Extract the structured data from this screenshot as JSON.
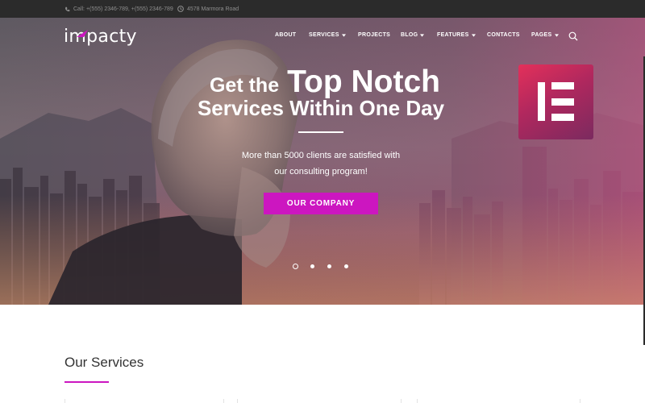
{
  "topbar": {
    "phone_icon": "phone-icon",
    "phone_text": "Call: +(555) 2346-789, +(555) 2346-789",
    "clock_icon": "clock-icon",
    "address_text": "4578 Marmora Road"
  },
  "header": {
    "logo_text": "impacty",
    "nav": [
      {
        "label": "ABOUT",
        "dropdown": false
      },
      {
        "label": "SERVICES",
        "dropdown": true
      },
      {
        "label": "PROJECTS",
        "dropdown": false
      },
      {
        "label": "BLOG",
        "dropdown": true
      },
      {
        "label": "FEATURES",
        "dropdown": true
      },
      {
        "label": "CONTACTS",
        "dropdown": false
      },
      {
        "label": "PAGES",
        "dropdown": true
      }
    ],
    "search_icon": "search-icon"
  },
  "hero": {
    "headline_small": "Get the",
    "headline_big": "Top Notch",
    "headline_line2": "Services Within One Day",
    "sub_line1": "More than 5000 clients are satisfied with",
    "sub_line2": "our consulting program!",
    "cta_label": "OUR COMPANY",
    "slides_total": 4,
    "slide_active": 1
  },
  "badge": {
    "icon": "elementor-logo-icon"
  },
  "services": {
    "title": "Our Services"
  },
  "colors": {
    "accent": "#cc16c0",
    "topbar": "#2b2b2b",
    "badge_start": "#e3305a",
    "badge_end": "#7b2a5f"
  }
}
